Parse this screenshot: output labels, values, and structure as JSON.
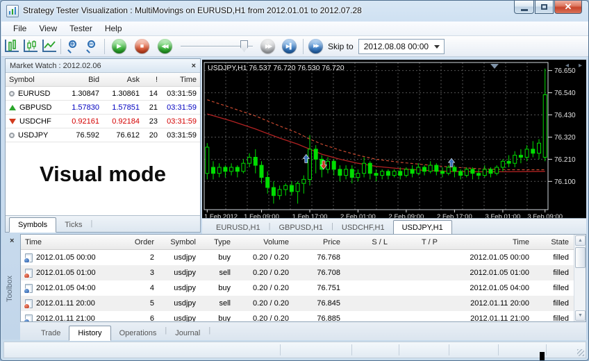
{
  "window": {
    "title": "Strategy Tester Visualization : MultiMovings on EURUSD,H1 from 2012.01.01 to 2012.07.28"
  },
  "menu": {
    "items": [
      "File",
      "View",
      "Tester",
      "Help"
    ]
  },
  "toolbar": {
    "skip_to_label": "Skip to",
    "skip_to_value": "2012.08.08 00:00",
    "icons": {
      "play": "▶",
      "stop": "■",
      "rewind": "◀◀",
      "fast_forward": "▶▶",
      "skip_end": "▶▌",
      "skip_to": "▶▶",
      "zoom_in": "+",
      "zoom_out": "−",
      "tab_arrow_left": "◂",
      "tab_arrow_right": "▸",
      "scroll_up": "▲",
      "scroll_down": "▼"
    }
  },
  "market_watch": {
    "title": "Market Watch : 2012.02.06",
    "close_glyph": "×",
    "columns": [
      "Symbol",
      "Bid",
      "Ask",
      "!",
      "Time"
    ],
    "colors": {
      "tick_up": "#0000c0",
      "tick_down": "#d40000",
      "neutral": "#000000"
    },
    "rows": [
      {
        "symbol": "EURUSD",
        "bid": "1.30847",
        "ask": "1.30861",
        "spread": "14",
        "time": "03:31:59",
        "trend": "flat",
        "tick": "neutral"
      },
      {
        "symbol": "GBPUSD",
        "bid": "1.57830",
        "ask": "1.57851",
        "spread": "21",
        "time": "03:31:59",
        "trend": "up",
        "tick": "tick_up"
      },
      {
        "symbol": "USDCHF",
        "bid": "0.92161",
        "ask": "0.92184",
        "spread": "23",
        "time": "03:31:59",
        "trend": "down",
        "tick": "tick_down"
      },
      {
        "symbol": "USDJPY",
        "bid": "76.592",
        "ask": "76.612",
        "spread": "20",
        "time": "03:31:59",
        "trend": "flat",
        "tick": "neutral"
      }
    ],
    "overlay": "Visual mode",
    "tabs": [
      "Symbols",
      "Ticks"
    ],
    "active_tab": "Symbols"
  },
  "chart": {
    "tabs": [
      "EURUSD,H1",
      "GBPUSD,H1",
      "USDCHF,H1",
      "USDJPY,H1"
    ],
    "active_tab": "USDJPY,H1"
  },
  "chart_data": {
    "type": "candlestick",
    "symbol": "USDJPY",
    "timeframe": "H1",
    "ohlc_header": {
      "open": "76.537",
      "high": "76.720",
      "low": "76.530",
      "close": "76.720"
    },
    "colors": {
      "background": "#000000",
      "grid": "#555555",
      "candle": "#00dd00",
      "ma_solid": "#b22222",
      "ma_dashed": "#c84a30",
      "buy_arrow": "#3b6fb5",
      "sell_arrow": "#cc3b1e",
      "axis_text": "#e2e2e2"
    },
    "price_range": [
      75.96,
      76.69
    ],
    "y_ticks": [
      76.65,
      76.54,
      76.43,
      76.32,
      76.21,
      76.1
    ],
    "x_ticks": [
      {
        "label": "1 Feb 2012",
        "index": 0
      },
      {
        "label": "1 Feb 09:00",
        "index": 9
      },
      {
        "label": "1 Feb 17:00",
        "index": 17
      },
      {
        "label": "2 Feb 01:00",
        "index": 25
      },
      {
        "label": "2 Feb 09:00",
        "index": 33
      },
      {
        "label": "2 Feb 17:00",
        "index": 41
      },
      {
        "label": "3 Feb 01:00",
        "index": 49
      },
      {
        "label": "3 Feb 09:00",
        "index": 56
      }
    ],
    "candles": [
      [
        76.14,
        76.29,
        76.11,
        76.27
      ],
      [
        76.17,
        76.2,
        76.11,
        76.14
      ],
      [
        76.14,
        76.19,
        76.12,
        76.17
      ],
      [
        76.17,
        76.18,
        76.12,
        76.15
      ],
      [
        76.15,
        76.19,
        76.13,
        76.17
      ],
      [
        76.17,
        76.18,
        76.12,
        76.15
      ],
      [
        76.15,
        76.21,
        76.14,
        76.19
      ],
      [
        76.19,
        76.24,
        76.17,
        76.22
      ],
      [
        76.22,
        76.26,
        76.14,
        76.18
      ],
      [
        76.18,
        76.2,
        76.09,
        76.12
      ],
      [
        76.12,
        76.15,
        76.04,
        76.07
      ],
      [
        76.07,
        76.1,
        75.99,
        76.03
      ],
      [
        76.03,
        76.08,
        76.01,
        76.06
      ],
      [
        76.06,
        76.09,
        76.03,
        76.08
      ],
      [
        76.08,
        76.1,
        76.03,
        76.05
      ],
      [
        76.05,
        76.1,
        75.99,
        76.09
      ],
      [
        76.09,
        76.13,
        76.04,
        76.11
      ],
      [
        76.11,
        76.33,
        76.08,
        76.26
      ],
      [
        76.26,
        76.28,
        76.14,
        76.21
      ],
      [
        76.21,
        76.23,
        76.12,
        76.16
      ],
      [
        76.16,
        76.22,
        76.14,
        76.2
      ],
      [
        76.2,
        76.21,
        76.13,
        76.16
      ],
      [
        76.16,
        76.18,
        76.1,
        76.13
      ],
      [
        76.13,
        76.18,
        76.11,
        76.16
      ],
      [
        76.16,
        76.18,
        76.09,
        76.12
      ],
      [
        76.12,
        76.16,
        76.1,
        76.14
      ],
      [
        76.14,
        76.22,
        76.12,
        76.19
      ],
      [
        76.19,
        76.2,
        76.11,
        76.14
      ],
      [
        76.14,
        76.16,
        76.1,
        76.13
      ],
      [
        76.13,
        76.16,
        76.11,
        76.15
      ],
      [
        76.15,
        76.16,
        76.11,
        76.13
      ],
      [
        76.13,
        76.16,
        76.12,
        76.15
      ],
      [
        76.15,
        76.17,
        76.11,
        76.13
      ],
      [
        76.13,
        76.17,
        76.12,
        76.16
      ],
      [
        76.16,
        76.18,
        76.12,
        76.14
      ],
      [
        76.14,
        76.19,
        76.13,
        76.17
      ],
      [
        76.17,
        76.18,
        76.13,
        76.15
      ],
      [
        76.15,
        76.2,
        76.14,
        76.18
      ],
      [
        76.18,
        76.19,
        76.13,
        76.15
      ],
      [
        76.15,
        76.17,
        76.12,
        76.14
      ],
      [
        76.14,
        76.18,
        76.13,
        76.17
      ],
      [
        76.17,
        76.18,
        76.12,
        76.15
      ],
      [
        76.15,
        76.16,
        76.11,
        76.13
      ],
      [
        76.13,
        76.17,
        76.12,
        76.16
      ],
      [
        76.16,
        76.17,
        76.11,
        76.14
      ],
      [
        76.14,
        76.16,
        76.11,
        76.13
      ],
      [
        76.13,
        76.18,
        76.12,
        76.16
      ],
      [
        76.16,
        76.17,
        76.12,
        76.14
      ],
      [
        76.14,
        76.18,
        76.13,
        76.17
      ],
      [
        76.17,
        76.21,
        76.15,
        76.2
      ],
      [
        76.2,
        76.23,
        76.17,
        76.19
      ],
      [
        76.19,
        76.25,
        76.17,
        76.23
      ],
      [
        76.23,
        76.26,
        76.19,
        76.22
      ],
      [
        76.22,
        76.28,
        76.2,
        76.26
      ],
      [
        76.26,
        76.3,
        76.22,
        76.24
      ],
      [
        76.24,
        76.31,
        76.21,
        76.29
      ],
      [
        76.22,
        76.66,
        76.2,
        76.53
      ]
    ],
    "ma_solid": [
      [
        0,
        76.435
      ],
      [
        4,
        76.4
      ],
      [
        8,
        76.36
      ],
      [
        12,
        76.315
      ],
      [
        15,
        76.285
      ],
      [
        17,
        76.26
      ],
      [
        19,
        76.235
      ],
      [
        22,
        76.21
      ],
      [
        25,
        76.19
      ],
      [
        28,
        76.175
      ],
      [
        32,
        76.163
      ],
      [
        36,
        76.155
      ],
      [
        40,
        76.15
      ],
      [
        45,
        76.148
      ],
      [
        50,
        76.148
      ],
      [
        56,
        76.15
      ]
    ],
    "ma_dashed": [
      [
        0,
        76.505
      ],
      [
        4,
        76.465
      ],
      [
        8,
        76.425
      ],
      [
        12,
        76.375
      ],
      [
        15,
        76.34
      ],
      [
        17,
        76.31
      ],
      [
        19,
        76.285
      ],
      [
        22,
        76.255
      ],
      [
        25,
        76.23
      ],
      [
        28,
        76.21
      ],
      [
        32,
        76.195
      ],
      [
        36,
        76.183
      ],
      [
        40,
        76.172
      ],
      [
        45,
        76.163
      ],
      [
        50,
        76.158
      ],
      [
        56,
        76.158
      ]
    ],
    "trade_arrows": [
      {
        "type": "buy",
        "index": 16.4,
        "price": 76.21
      },
      {
        "type": "sell",
        "index": 19.3,
        "price": 76.185
      },
      {
        "type": "buy",
        "index": 40.5,
        "price": 76.19
      }
    ]
  },
  "history": {
    "toolbox_label": "Toolbox",
    "close_glyph": "×",
    "columns": [
      "Time",
      "Order",
      "Symbol",
      "Type",
      "Volume",
      "Price",
      "S / L",
      "T / P",
      "Time",
      "State"
    ],
    "rows": [
      {
        "icon": "buy",
        "time": "2012.01.05 00:00",
        "order": "2",
        "symbol": "usdjpy",
        "type": "buy",
        "volume": "0.20 / 0.20",
        "price": "76.768",
        "sl": "",
        "tp": "",
        "time2": "2012.01.05 00:00",
        "state": "filled"
      },
      {
        "icon": "sell",
        "time": "2012.01.05 01:00",
        "order": "3",
        "symbol": "usdjpy",
        "type": "sell",
        "volume": "0.20 / 0.20",
        "price": "76.708",
        "sl": "",
        "tp": "",
        "time2": "2012.01.05 01:00",
        "state": "filled"
      },
      {
        "icon": "buy",
        "time": "2012.01.05 04:00",
        "order": "4",
        "symbol": "usdjpy",
        "type": "buy",
        "volume": "0.20 / 0.20",
        "price": "76.751",
        "sl": "",
        "tp": "",
        "time2": "2012.01.05 04:00",
        "state": "filled"
      },
      {
        "icon": "sell",
        "time": "2012.01.11 20:00",
        "order": "5",
        "symbol": "usdjpy",
        "type": "sell",
        "volume": "0.20 / 0.20",
        "price": "76.845",
        "sl": "",
        "tp": "",
        "time2": "2012.01.11 20:00",
        "state": "filled"
      },
      {
        "icon": "buy",
        "time": "2012.01.11 21:00",
        "order": "6",
        "symbol": "usdjpy",
        "type": "buy",
        "volume": "0.20 / 0.20",
        "price": "76.885",
        "sl": "",
        "tp": "",
        "time2": "2012.01.11 21:00",
        "state": "filled"
      }
    ],
    "tabs": [
      "Trade",
      "History",
      "Operations",
      "Journal"
    ],
    "active_tab": "History"
  }
}
